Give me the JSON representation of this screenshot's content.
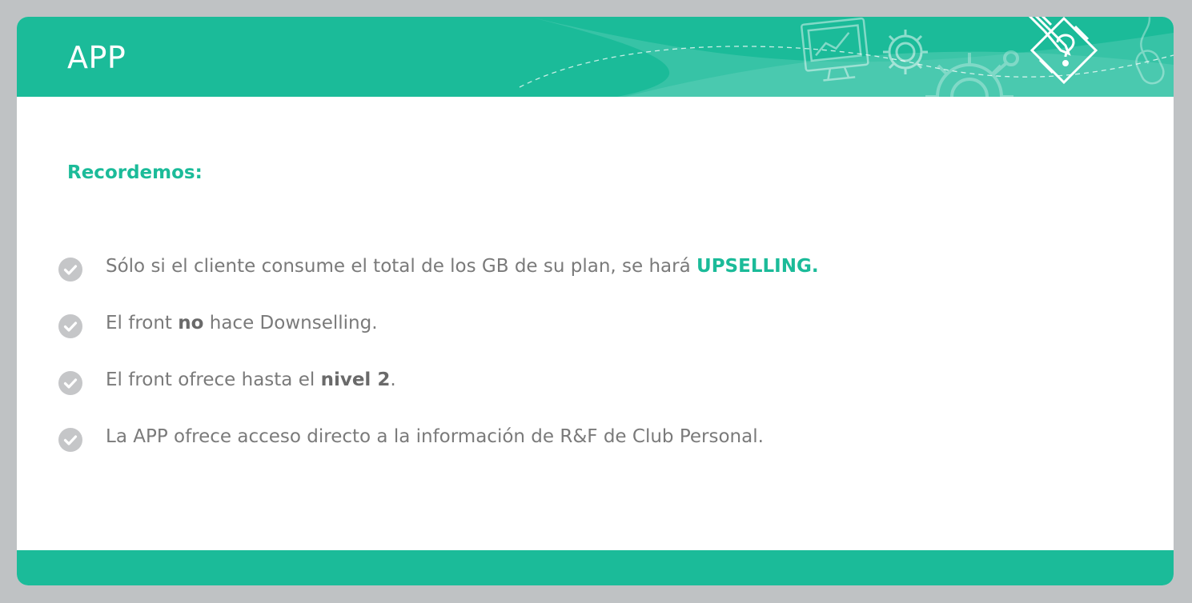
{
  "header": {
    "title": "APP"
  },
  "content": {
    "subtitle": "Recordemos:",
    "bullets": [
      {
        "before": "Sólo si el cliente consume el total de los GB de su plan, se hará ",
        "emphasis": "UPSELLING.",
        "after": ""
      },
      {
        "before": "El front ",
        "emphasis": "no",
        "after": " hace Downselling."
      },
      {
        "before": "El front ofrece hasta el ",
        "emphasis": "nivel 2",
        "after": "."
      },
      {
        "before": "La APP ofrece acceso directo a la información de R&F de Club Personal.",
        "emphasis": "",
        "after": ""
      }
    ]
  },
  "icons": {
    "bullet": "check-circle-icon",
    "header_decor": [
      "monitor-chart-icon",
      "gear-icon",
      "large-gear-icon",
      "mouse-icon",
      "pencil-question-icon"
    ]
  },
  "colors": {
    "accent": "#1bbb99",
    "accent_light": "#4fcab0",
    "text": "#7a7a7a",
    "check_bg": "#c5c6c8",
    "frame": "#bfc2c4"
  }
}
